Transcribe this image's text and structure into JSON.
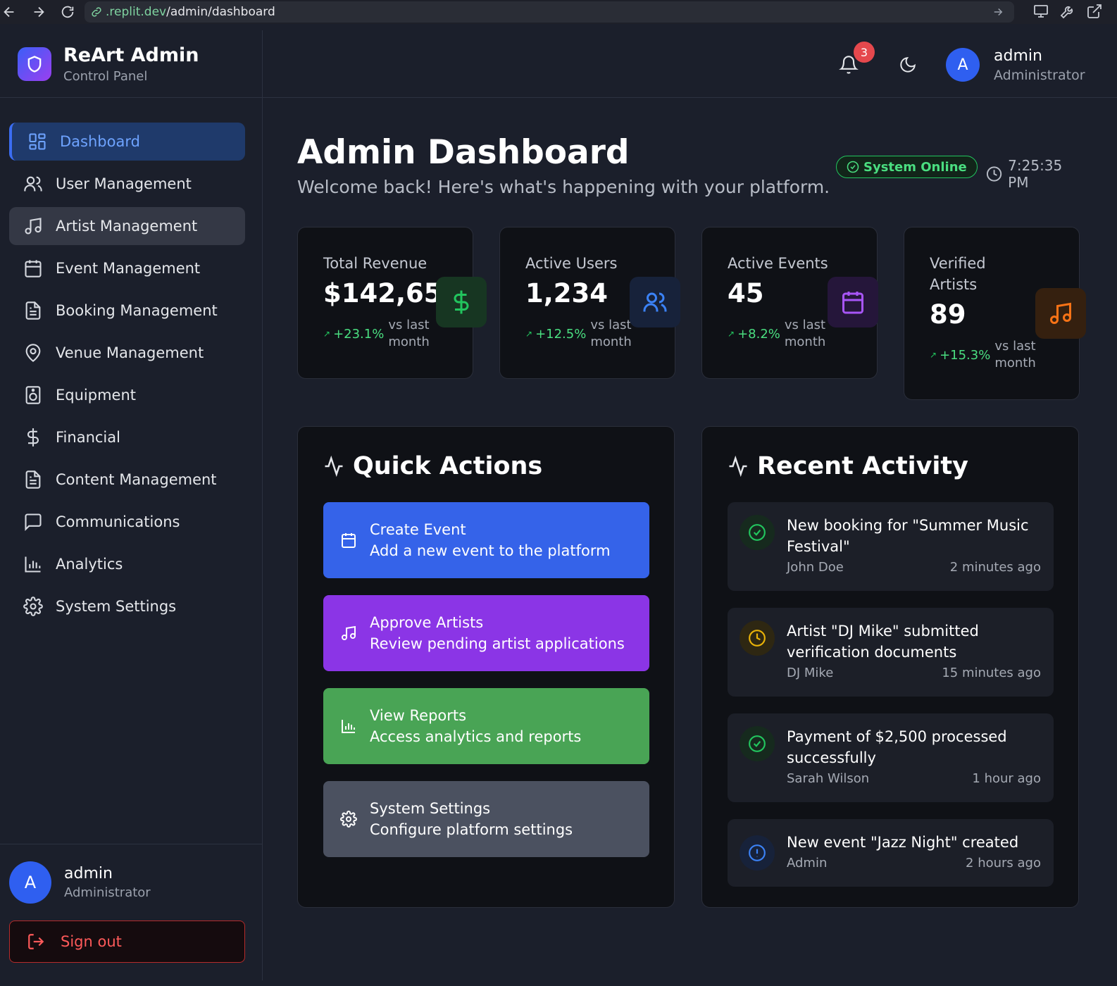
{
  "browser": {
    "url_domain": ".replit.dev",
    "url_path": "/admin/dashboard"
  },
  "brand": {
    "title": "ReArt Admin",
    "subtitle": "Control Panel",
    "icon": "shield-icon"
  },
  "sidebar": {
    "items": [
      {
        "label": "Dashboard",
        "icon": "dashboard-grid-icon",
        "state": "active"
      },
      {
        "label": "User Management",
        "icon": "users-icon"
      },
      {
        "label": "Artist Management",
        "icon": "music-note-icon",
        "state": "hover"
      },
      {
        "label": "Event Management",
        "icon": "calendar-icon"
      },
      {
        "label": "Booking Management",
        "icon": "document-icon"
      },
      {
        "label": "Venue Management",
        "icon": "map-pin-icon"
      },
      {
        "label": "Equipment",
        "icon": "speaker-icon"
      },
      {
        "label": "Financial",
        "icon": "dollar-icon"
      },
      {
        "label": "Content Management",
        "icon": "document-icon"
      },
      {
        "label": "Communications",
        "icon": "chat-bubble-icon"
      },
      {
        "label": "Analytics",
        "icon": "bar-chart-icon"
      },
      {
        "label": "System Settings",
        "icon": "gear-icon"
      }
    ],
    "user": {
      "avatar": "A",
      "name": "admin",
      "role": "Administrator"
    },
    "sign_out": "Sign out"
  },
  "header": {
    "notifications_count": "3",
    "user": {
      "avatar": "A",
      "name": "admin",
      "role": "Administrator"
    }
  },
  "page": {
    "title": "Admin Dashboard",
    "subtitle": "Welcome back! Here's what's happening with your platform.",
    "status": "System Online",
    "time": "7:25:35 PM"
  },
  "stats": [
    {
      "label": "Total Revenue",
      "value": "$142,650",
      "change": "+23.1%",
      "note": "vs last month",
      "icon": "dollar-icon",
      "color": "#22c55e"
    },
    {
      "label": "Active Users",
      "value": "1,234",
      "change": "+12.5%",
      "note": "vs last month",
      "icon": "users-icon",
      "color": "#3b82f6"
    },
    {
      "label": "Active Events",
      "value": "45",
      "change": "+8.2%",
      "note": "vs last month",
      "icon": "calendar-icon",
      "color": "#a855f7"
    },
    {
      "label": "Verified Artists",
      "value": "89",
      "change": "+15.3%",
      "note": "vs last month",
      "icon": "music-note-icon",
      "color": "#f97316"
    }
  ],
  "quick_actions": {
    "title": "Quick Actions",
    "items": [
      {
        "title": "Create Event",
        "desc": "Add a new event to the platform",
        "icon": "calendar-icon",
        "color": "#3563e9"
      },
      {
        "title": "Approve Artists",
        "desc": "Review pending artist applications",
        "icon": "music-note-icon",
        "color": "#8b35e6"
      },
      {
        "title": "View Reports",
        "desc": "Access analytics and reports",
        "icon": "bar-chart-icon",
        "color": "#49a455"
      },
      {
        "title": "System Settings",
        "desc": "Configure platform settings",
        "icon": "gear-icon",
        "color": "#4b5160"
      }
    ]
  },
  "recent_activity": {
    "title": "Recent Activity",
    "items": [
      {
        "text": "New booking for \"Summer Music Festival\"",
        "who": "John Doe",
        "when": "2 minutes ago",
        "icon": "check-circle-icon",
        "color": "#22c55e"
      },
      {
        "text": "Artist \"DJ Mike\" submitted verification documents",
        "who": "DJ Mike",
        "when": "15 minutes ago",
        "icon": "clock-icon",
        "color": "#eab308"
      },
      {
        "text": "Payment of $2,500 processed successfully",
        "who": "Sarah Wilson",
        "when": "1 hour ago",
        "icon": "check-circle-icon",
        "color": "#22c55e"
      },
      {
        "text": "New event \"Jazz Night\" created",
        "who": "Admin",
        "when": "2 hours ago",
        "icon": "alert-circle-icon",
        "color": "#3b82f6"
      }
    ]
  }
}
